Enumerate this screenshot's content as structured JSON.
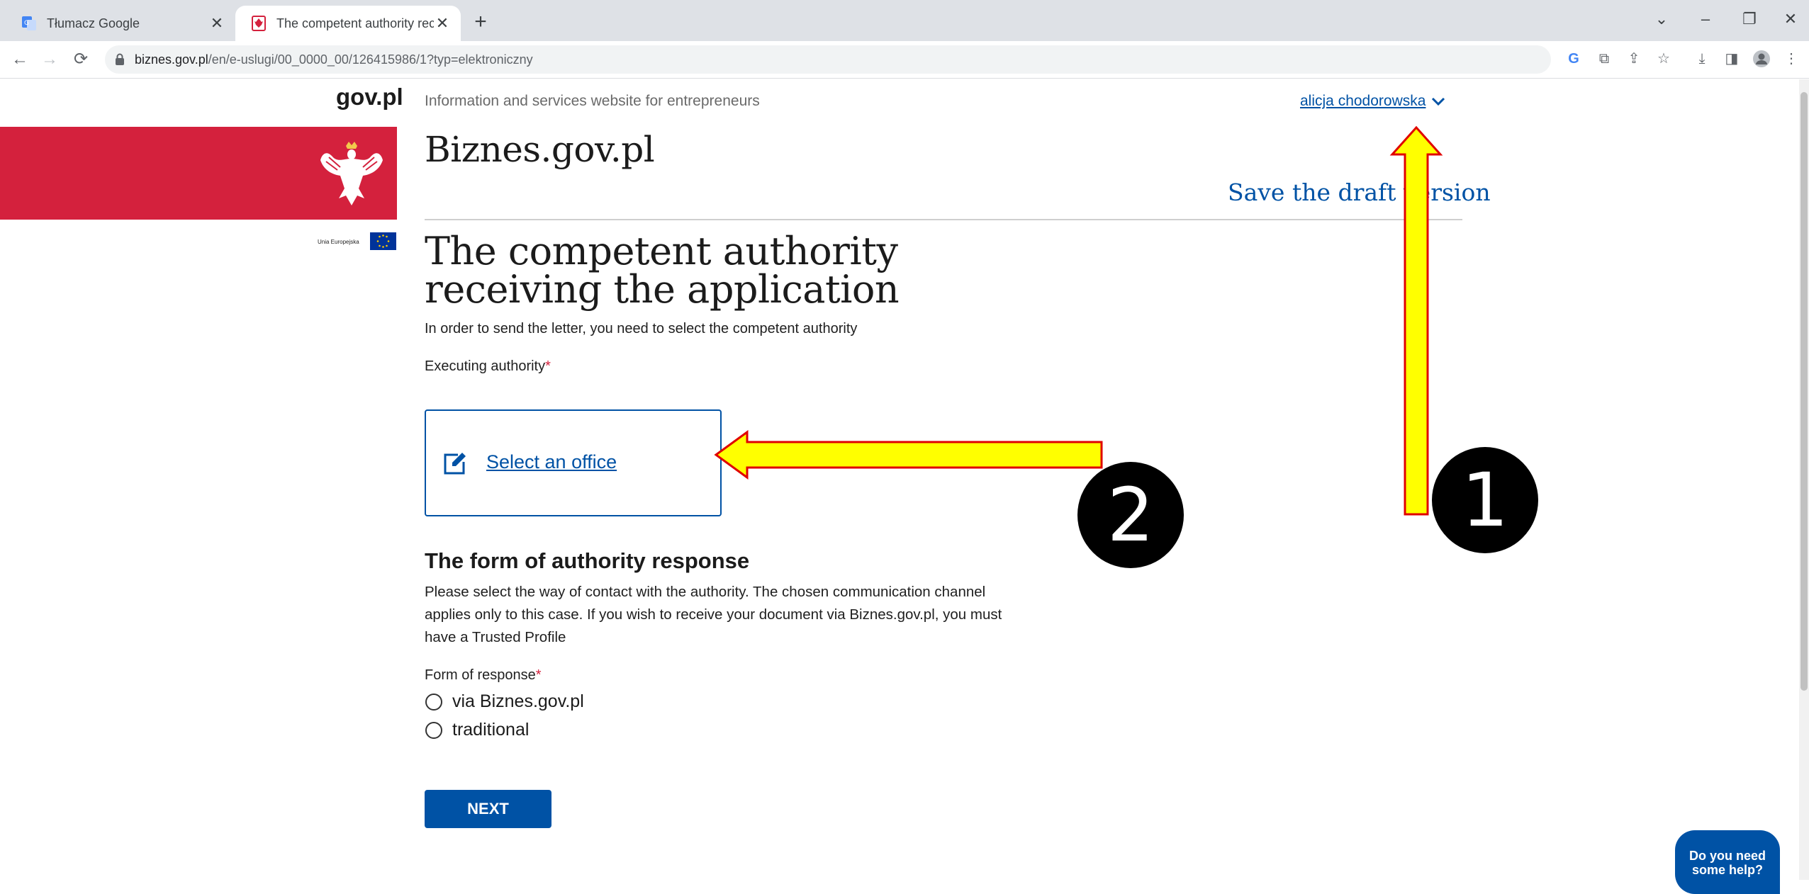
{
  "browser": {
    "tabs": [
      {
        "title": "Tłumacz Google",
        "favicon": "google-translate-icon",
        "active": false
      },
      {
        "title": "The competent authority receivin",
        "favicon": "polish-eagle-icon",
        "active": true
      }
    ],
    "url_host": "biznes.gov.pl",
    "url_path": "/en/e-uslugi/00_0000_00/126415986/1?typ=elektroniczny"
  },
  "header": {
    "gov_logo": "gov.pl",
    "site_description": "Information and services website for entrepreneurs",
    "user_name": "alicja chodorowska",
    "site_name": "Biznes.gov.pl",
    "save_draft": "Save the draft version",
    "eu_label": "Unia Europejska"
  },
  "main": {
    "title": "The competent authority receiving the application",
    "subtitle": "In order to send the letter, you need to select the competent authority",
    "executing_authority_label": "Executing authority",
    "required_mark": "*",
    "select_office": "Select an office",
    "form_heading": "The form of authority response",
    "form_description": "Please select the way of contact with the authority. The chosen communication channel applies only to this case. If you wish to receive your document via Biznes.gov.pl, you must have a Trusted Profile",
    "form_of_response_label": "Form of response",
    "options": [
      "via Biznes.gov.pl",
      "traditional"
    ],
    "next_button": "NEXT"
  },
  "help": {
    "line1": "Do you need",
    "line2": "some help?"
  },
  "annotations": {
    "badge1": "1",
    "badge2": "2"
  },
  "colors": {
    "brand_blue": "#0052a5",
    "brand_red": "#d4213d",
    "annotation_arrow": "#ffff00",
    "annotation_border": "#e00000"
  }
}
